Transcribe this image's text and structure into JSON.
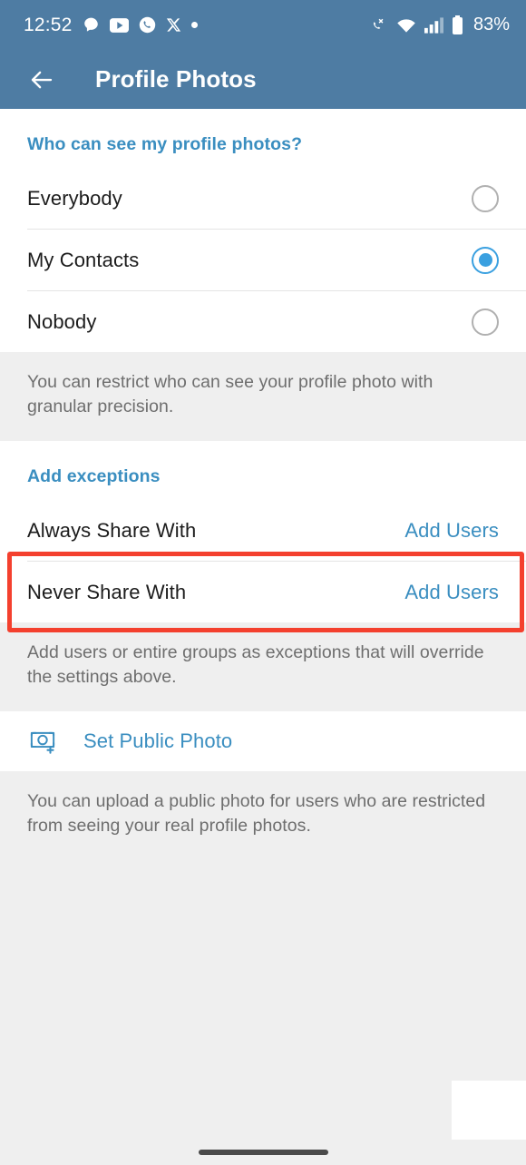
{
  "status_bar": {
    "time": "12:52",
    "battery_percent": "83%",
    "left_icons": [
      "chat-bubble-icon",
      "youtube-icon",
      "phone-circle-icon",
      "x-twitter-icon",
      "dot-icon"
    ],
    "right_icons": [
      "call-mute-icon",
      "wifi-icon",
      "signal-icon",
      "battery-icon"
    ]
  },
  "toolbar": {
    "back_icon": "back-arrow-icon",
    "title": "Profile Photos",
    "background_color": "#4e7ca3"
  },
  "visibility_section": {
    "header": "Who can see my profile photos?",
    "options": [
      {
        "label": "Everybody",
        "selected": false
      },
      {
        "label": "My Contacts",
        "selected": true
      },
      {
        "label": "Nobody",
        "selected": false
      }
    ],
    "footnote": "You can restrict who can see your profile photo with granular precision."
  },
  "exceptions_section": {
    "header": "Add exceptions",
    "rows": [
      {
        "label": "Always Share With",
        "action": "Add Users",
        "highlighted": false
      },
      {
        "label": "Never Share With",
        "action": "Add Users",
        "highlighted": true
      }
    ],
    "footnote": "Add users or entire groups as exceptions that will override the settings above."
  },
  "public_photo_section": {
    "icon": "camera-add-icon",
    "label": "Set Public Photo",
    "footnote": "You can upload a public photo for users who are restricted from seeing your real profile photos."
  },
  "colors": {
    "accent": "#3a8ec0",
    "radio_selected": "#3aa0e0",
    "highlight": "#f4402e",
    "toolbar": "#4e7ca3"
  }
}
